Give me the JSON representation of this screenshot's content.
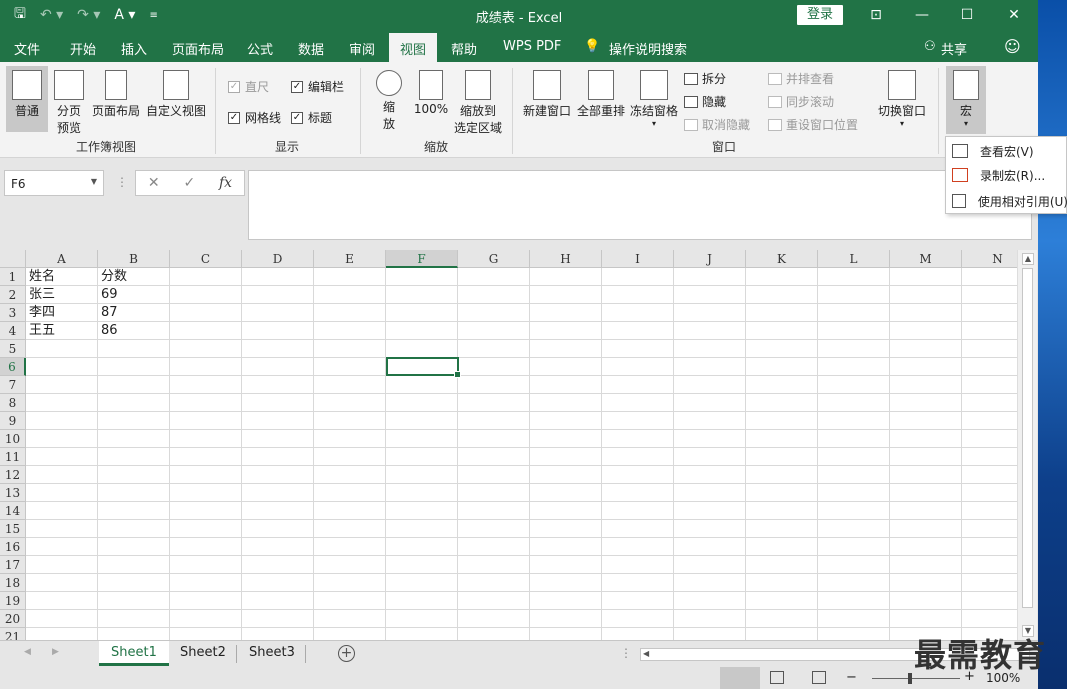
{
  "window": {
    "title": "成绩表  -  Excel",
    "login": "登录"
  },
  "menu": {
    "items": [
      "文件",
      "开始",
      "插入",
      "页面布局",
      "公式",
      "数据",
      "审阅",
      "视图",
      "帮助",
      "WPS PDF",
      "操作说明搜索"
    ],
    "share": "共享"
  },
  "ribbon": {
    "workbook_views": {
      "label": "工作簿视图",
      "normal": "普通",
      "page_break_1": "分页",
      "page_break_2": "预览",
      "page_layout": "页面布局",
      "custom_view": "自定义视图"
    },
    "show": {
      "label": "显示",
      "ruler": "直尺",
      "formula_bar": "编辑栏",
      "gridlines": "网格线",
      "headings": "标题"
    },
    "zoom": {
      "label": "缩放",
      "zoom_1": "缩",
      "zoom_2": "放",
      "hundred": "100%",
      "to_sel_1": "缩放到",
      "to_sel_2": "选定区域"
    },
    "window": {
      "label": "窗口",
      "new_window": "新建窗口",
      "arrange_all": "全部重排",
      "freeze_panes": "冻结窗格",
      "split": "拆分",
      "hide": "隐藏",
      "unhide": "取消隐藏",
      "side_by_side": "并排查看",
      "sync_scroll": "同步滚动",
      "reset_position": "重设窗口位置",
      "switch_windows": "切换窗口"
    },
    "macros": {
      "label": "宏"
    }
  },
  "macro_menu": {
    "view": "查看宏(V)",
    "record": "录制宏(R)...",
    "relative": "使用相对引用(U)"
  },
  "formula_bar": {
    "name_box": "F6",
    "cancel": "✕",
    "enter": "✓",
    "fx": "fx"
  },
  "columns": [
    "A",
    "B",
    "C",
    "D",
    "E",
    "F",
    "G",
    "H",
    "I",
    "J",
    "K",
    "L",
    "M",
    "N"
  ],
  "rows": [
    "1",
    "2",
    "3",
    "4",
    "5",
    "6",
    "7",
    "8",
    "9",
    "10",
    "11",
    "12",
    "13",
    "14",
    "15",
    "16",
    "17",
    "18",
    "19",
    "20",
    "21"
  ],
  "cells": {
    "A1": "姓名",
    "B1": "分数",
    "A2": "张三",
    "B2": "69",
    "A3": "李四",
    "B3": "87",
    "A4": "王五",
    "B4": "86"
  },
  "sheets": [
    "Sheet1",
    "Sheet2",
    "Sheet3"
  ],
  "status": {
    "zoom_minus": "−",
    "zoom_plus": "+",
    "zoom": "100%"
  },
  "watermark": "最需教育",
  "colors": {
    "accent": "#217346"
  }
}
